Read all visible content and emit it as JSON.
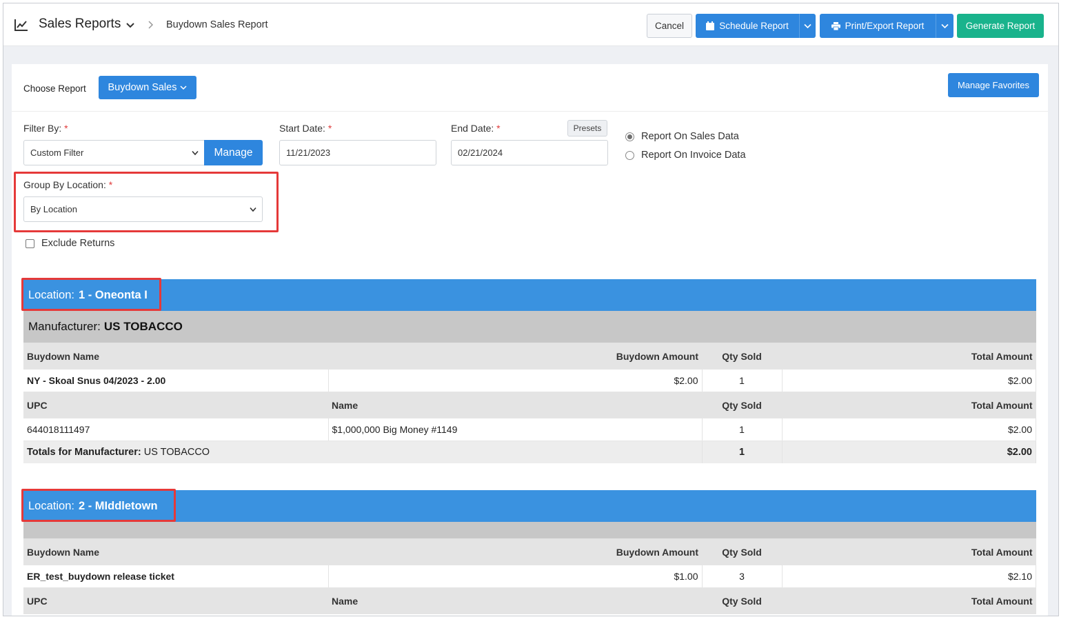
{
  "header": {
    "title": "Sales Reports",
    "breadcrumb": "Buydown Sales Report",
    "cancel_label": "Cancel",
    "schedule_label": "Schedule Report",
    "print_label": "Print/Export Report",
    "generate_label": "Generate Report"
  },
  "controls": {
    "choose_report_label": "Choose Report",
    "choose_report_value": "Buydown Sales",
    "manage_favorites_label": "Manage Favorites",
    "filter_by_label": "Filter By:",
    "filter_by_value": "Custom Filter",
    "manage_label": "Manage",
    "start_date_label": "Start Date:",
    "start_date_value": "11/21/2023",
    "end_date_label": "End Date:",
    "end_date_value": "02/21/2024",
    "presets_label": "Presets",
    "required_mark": "*",
    "report_options": [
      {
        "label": "Report On Sales Data",
        "selected": true
      },
      {
        "label": "Report On Invoice Data",
        "selected": false
      }
    ],
    "group_by_label": "Group By Location:",
    "group_by_value": "By Location",
    "exclude_returns_label": "Exclude Returns",
    "exclude_returns_checked": false
  },
  "report": {
    "location_prefix": "Location:",
    "manufacturer_prefix": "Manufacturer:",
    "totals_prefix": "Totals for Manufacturer:",
    "buydown_headers": [
      "Buydown Name",
      "Buydown Amount",
      "Qty Sold",
      "Total Amount"
    ],
    "upc_headers": [
      "UPC",
      "Name",
      "Qty Sold",
      "Total Amount"
    ],
    "locations": [
      {
        "name": "1 - Oneonta I",
        "manufacturer": "US TOBACCO",
        "buydown": {
          "name": "NY - Skoal Snus 04/2023 - 2.00",
          "amount": "$2.00",
          "qty": "1",
          "total": "$2.00"
        },
        "item": {
          "upc": "644018111497",
          "name": "$1,000,000 Big Money #1149",
          "qty": "1",
          "total": "$2.00"
        },
        "totals": {
          "manufacturer": "US TOBACCO",
          "qty": "1",
          "total": "$2.00"
        }
      },
      {
        "name": "2 - MIddletown",
        "manufacturer": "",
        "buydown": {
          "name": "ER_test_buydown release ticket",
          "amount": "$1.00",
          "qty": "3",
          "total": "$2.10"
        }
      }
    ]
  },
  "colors": {
    "primary_blue": "#2e86de",
    "location_bar": "#3a92e0",
    "generate_green": "#19b38c",
    "highlight_red": "#e53939"
  },
  "icons": {
    "title": "line-chart-icon",
    "schedule": "calendar-icon",
    "print": "printer-icon"
  }
}
